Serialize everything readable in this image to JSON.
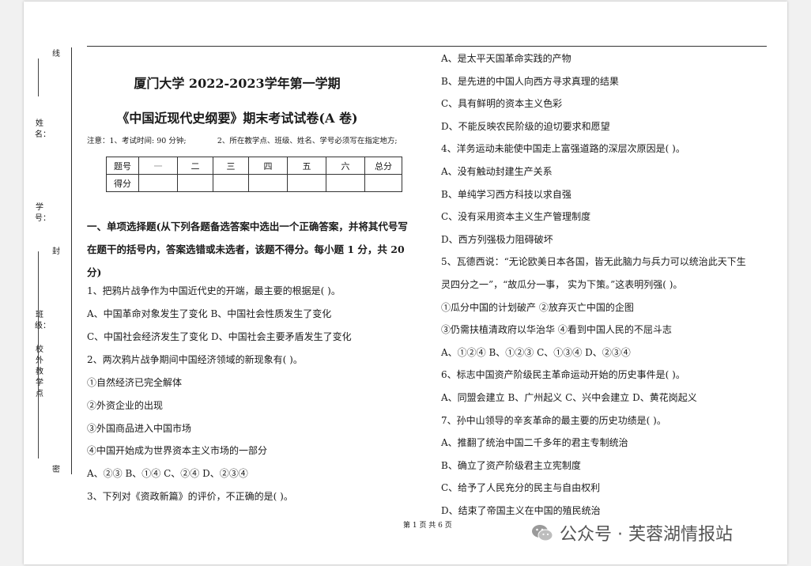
{
  "margin": {
    "xian": "线",
    "xingming": "姓名：",
    "xuehao": "学号：",
    "feng": "封",
    "banji": "班级：",
    "xiaowai": "校外教学点",
    "mi": "密"
  },
  "header": {
    "title1": "厦门大学 2022-2023学年第一学期",
    "title2": "《中国近现代史纲要》期末考试试卷(A 卷)",
    "notice": "注意：1、考试时间: 90 分钟;             2、所在教学点、班级、姓名、学号必须写在指定地方;"
  },
  "score_table": {
    "row1": [
      "题号",
      "一",
      "二",
      "三",
      "四",
      "五",
      "六",
      "总分"
    ],
    "row2_label": "得分"
  },
  "section_title": "一、单项选择题(从下列各题备选答案中选出一个正确答案，并将其代号写在题干的括号内，答案选错或未选者，该题不得分。每小题 1 分，共 20 分)",
  "left_lines": [
    "1、把鸦片战争作为中国近代史的开端，最主要的根据是(          )。",
    "A、中国革命对象发生了变化          B、中国社会性质发生了变化",
    "C、中国社会经济发生了变化          D、中国社会主要矛盾发生了变化",
    "2、两次鸦片战争期间中国经济领域的新现象有(          )。",
    "①自然经济已完全解体",
    "②外资企业的出现",
    "③外国商品进入中国市场",
    "④中国开始成为世界资本主义市场的一部分",
    " A、②③      B、①④      C、②④      D、②③④",
    "3、下列对《资政新篇》的评价，不正确的是(          )。"
  ],
  "right_lines": [
    "A、是太平天国革命实践的产物",
    "B、是先进的中国人向西方寻求真理的结果",
    "C、具有鲜明的资本主义色彩",
    "D、不能反映农民阶级的迫切要求和愿望",
    "4、洋务运动未能使中国走上富强道路的深层次原因是(          )。",
    "A、没有触动封建生产关系",
    "B、单纯学习西方科技以求自强",
    "C、没有采用资本主义生产管理制度",
    "D、西方列强极力阻碍破坏",
    "5、瓦德西说：“无论欧美日本各国，皆无此脑力与兵力可以统治此天下生",
    "灵四分之一”，“故瓜分一事，  实为下策。”这表明列强(          )。",
    "①瓜分中国的计划破产                      ②放弃灭亡中国的企图",
    "③仍需扶植清政府以华治华                ④看到中国人民的不屈斗志",
    "  A、①②④        B、①②③        C、①③④        D、②③④",
    "6、标志中国资产阶级民主革命运动开始的历史事件是(          )。",
    "A、同盟会建立    B、广州起义    C、兴中会建立    D、黄花岗起义",
    "7、孙中山领导的辛亥革命的最主要的历史功绩是(          )。",
    "A、推翻了统治中国二千多年的君主专制统治",
    "B、确立了资产阶级君主立宪制度",
    "C、给予了人民充分的民主与自由权利",
    "D、结束了帝国主义在中国的殖民统治"
  ],
  "footer": "第 1 页 共 6 页",
  "watermark": "公众号 · 芙蓉湖情报站"
}
